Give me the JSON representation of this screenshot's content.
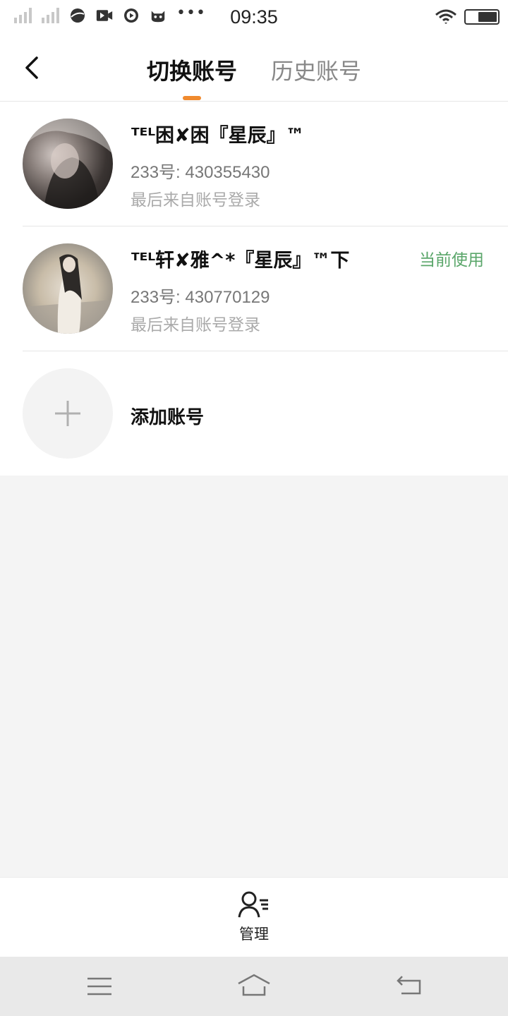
{
  "status_bar": {
    "time": "09:35",
    "icons": [
      "signal-1-icon",
      "signal-2-icon",
      "browser-icon",
      "video-icon",
      "play-icon",
      "cat-app-icon",
      "more-dots-icon",
      "wifi-icon",
      "battery-icon"
    ],
    "more": "•••"
  },
  "header": {
    "back_icon": "chevron-left-icon",
    "tabs": [
      {
        "label": "切换账号",
        "active": true
      },
      {
        "label": "历史账号",
        "active": false
      }
    ],
    "indicator_color": "#f08a2e"
  },
  "accounts": [
    {
      "name": "ᵀᴱᴸ困✘困『星辰』™",
      "account_id": "233号: 430355430",
      "last_login": "最后来自账号登录",
      "current": false
    },
    {
      "name": "ᵀᴱᴸ轩✘雅^*『星辰』™下",
      "account_id": "233号: 430770129",
      "last_login": "最后来自账号登录",
      "current": true,
      "current_label": "当前使用"
    }
  ],
  "add_account": {
    "label": "添加账号",
    "icon": "plus-icon"
  },
  "manage": {
    "label": "管理",
    "icon": "user-list-icon"
  },
  "nav_bar": {
    "icons": [
      "menu-icon",
      "home-icon",
      "back-icon"
    ]
  },
  "colors": {
    "accent": "#f08a2e",
    "current_tag": "#5aa66a",
    "background": "#f4f4f4"
  }
}
